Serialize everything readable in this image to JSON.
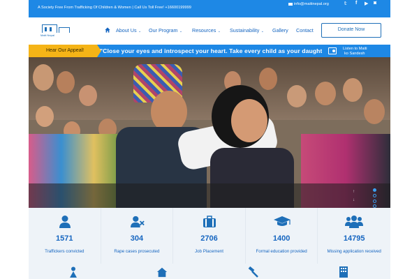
{
  "topbar": {
    "tagline": "A Society Free From Trafficking Of Children & Women | Call Us Toll Free! +16600199999",
    "email": "info@maitinepal.org",
    "social": [
      "twitter-icon",
      "facebook-icon",
      "youtube-icon",
      "instagram-icon"
    ]
  },
  "logo": {
    "text": "Maiti Nepal",
    "subtitle": "माइती नेपाल"
  },
  "nav": {
    "home_icon": "home-icon",
    "items": [
      {
        "label": "About Us",
        "dropdown": true
      },
      {
        "label": "Our Program",
        "dropdown": true
      },
      {
        "label": "Resources",
        "dropdown": true
      },
      {
        "label": "Sustainability",
        "dropdown": true
      },
      {
        "label": "Gallery",
        "dropdown": false
      },
      {
        "label": "Contact",
        "dropdown": false
      }
    ],
    "donate_label": "Donate Now"
  },
  "appeal": {
    "badge": "Hear Our Appeal!",
    "quote": "\"Close your eyes and introspect your heart. Take every child as your daughte..",
    "radio_line1": "Listen to Maiti",
    "radio_line2": "ko Sandesh"
  },
  "stats": [
    {
      "icon": "person-icon",
      "value": "1571",
      "label": "Traffickers convicted"
    },
    {
      "icon": "person-remove-icon",
      "value": "304",
      "label": "Rape cases prosecuted"
    },
    {
      "icon": "briefcase-icon",
      "value": "2706",
      "label": "Job Placement"
    },
    {
      "icon": "graduation-cap-icon",
      "value": "1400",
      "label": "Formal education provided"
    },
    {
      "icon": "users-icon",
      "value": "14795",
      "label": "Missing application received"
    }
  ],
  "colors": {
    "brand_blue": "#1e88e5",
    "accent_yellow": "#f5b417",
    "text_blue": "#1565c0"
  }
}
